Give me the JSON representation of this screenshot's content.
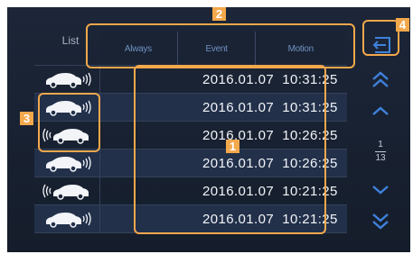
{
  "header": {
    "list_label": "List",
    "tabs": [
      "Always",
      "Event",
      "Motion"
    ]
  },
  "records": [
    {
      "icon": "car-signal-right-icon",
      "time": "2016.01.07  10:31:25"
    },
    {
      "icon": "car-signal-right-icon",
      "time": "2016.01.07  10:31:25"
    },
    {
      "icon": "car-signal-left-icon",
      "time": "2016.01.07  10:26:25"
    },
    {
      "icon": "car-signal-right-icon",
      "time": "2016.01.07  10:26:25"
    },
    {
      "icon": "car-signal-left-icon",
      "time": "2016.01.07  10:21:25"
    },
    {
      "icon": "car-signal-right-icon",
      "time": "2016.01.07  10:21:25"
    }
  ],
  "pager": {
    "current": "1",
    "total": "13"
  },
  "annotations": [
    "1",
    "2",
    "3",
    "4"
  ],
  "colors": {
    "accent": "#f3a84c",
    "background": "#1c2638",
    "icon": "#3f7fd8"
  }
}
